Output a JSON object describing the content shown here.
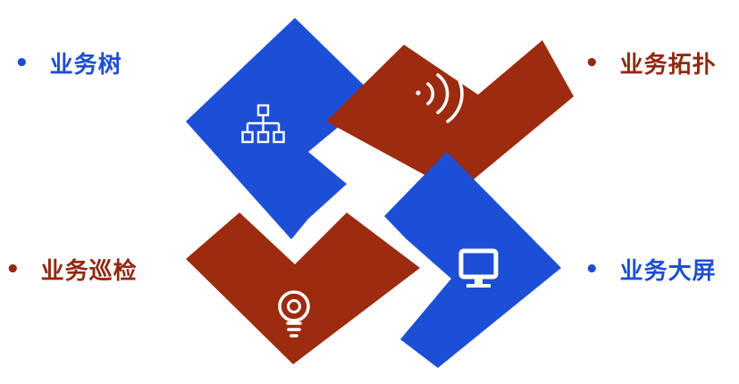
{
  "colors": {
    "blue": "#1D4FD6",
    "red": "#9C2B0F",
    "icon": "#FFFFFF"
  },
  "labels": {
    "tree": "业务树",
    "topology": "业务拓扑",
    "patrol": "业务巡检",
    "screen": "业务大屏"
  },
  "bullet": "•",
  "icons": {
    "tree": "hierarchy-icon",
    "topology": "signal-waves-icon",
    "patrol": "lightbulb-icon",
    "screen": "monitor-icon"
  }
}
